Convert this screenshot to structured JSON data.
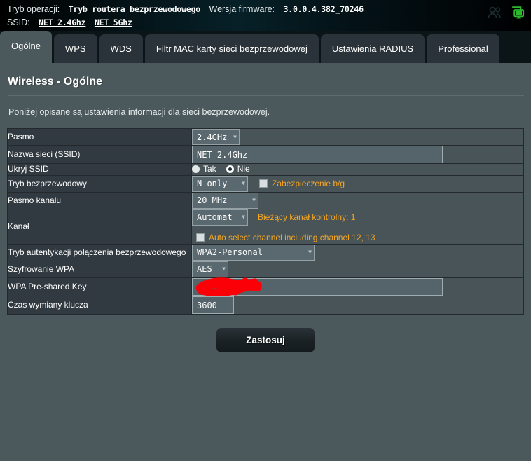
{
  "banner": {
    "op_mode_label": "Tryb operacji:",
    "op_mode_value": "Tryb routera bezprzewodowego",
    "firmware_label": "Wersja firmware:",
    "firmware_value": "3.0.0.4.382_70246",
    "ssid_label": "SSID:",
    "ssid_24": "NET 2.4Ghz",
    "ssid_5": "NET 5Ghz",
    "icons": {
      "clients": "users-icon",
      "network": "network-monitor-icon"
    }
  },
  "tabs": [
    {
      "label": "Ogólne",
      "active": true
    },
    {
      "label": "WPS",
      "active": false
    },
    {
      "label": "WDS",
      "active": false
    },
    {
      "label": "Filtr MAC karty sieci bezprzewodowej",
      "active": false
    },
    {
      "label": "Ustawienia RADIUS",
      "active": false
    },
    {
      "label": "Professional",
      "active": false
    }
  ],
  "page": {
    "title": "Wireless - Ogólne",
    "description": "Poniżej opisane są ustawienia informacji dla sieci bezprzewodowej."
  },
  "form": {
    "band": {
      "label": "Pasmo",
      "value": "2.4GHz"
    },
    "ssid": {
      "label": "Nazwa sieci (SSID)",
      "value": "NET 2.4Ghz"
    },
    "hide_ssid": {
      "label": "Ukryj SSID",
      "option_yes": "Tak",
      "option_no": "Nie",
      "selected": "Nie"
    },
    "wireless_mode": {
      "label": "Tryb bezprzewodowy",
      "value": "N only",
      "protect_label": "Zabezpieczenie b/g",
      "protect_checked": false
    },
    "channel_bandwidth": {
      "label": "Pasmo kanału",
      "value": "20 MHz"
    },
    "channel": {
      "label": "Kanał",
      "value": "Automat",
      "current_note": "Bieżący kanał kontrolny: 1",
      "auto_select_label": "Auto select channel including channel 12, 13",
      "auto_select_checked": false
    },
    "auth_method": {
      "label": "Tryb autentykacji połączenia bezprzewodowego",
      "value": "WPA2-Personal"
    },
    "wpa_encryption": {
      "label": "Szyfrowanie WPA",
      "value": "AES"
    },
    "wpa_key": {
      "label": "WPA Pre-shared Key",
      "value": "",
      "redacted": true
    },
    "rekey_interval": {
      "label": "Czas wymiany klucza",
      "value": "3600"
    }
  },
  "footer": {
    "apply_label": "Zastosuj"
  },
  "colors": {
    "page_bg": "#4b585c",
    "label_cell_bg": "#313a40",
    "value_cell_bg": "#485458",
    "accent_orange": "#f5a623",
    "banner_bg": "#041318",
    "tabbar_bg": "#0b1417",
    "redaction_red": "#fb0007",
    "network_icon_green": "#2cba2c"
  }
}
